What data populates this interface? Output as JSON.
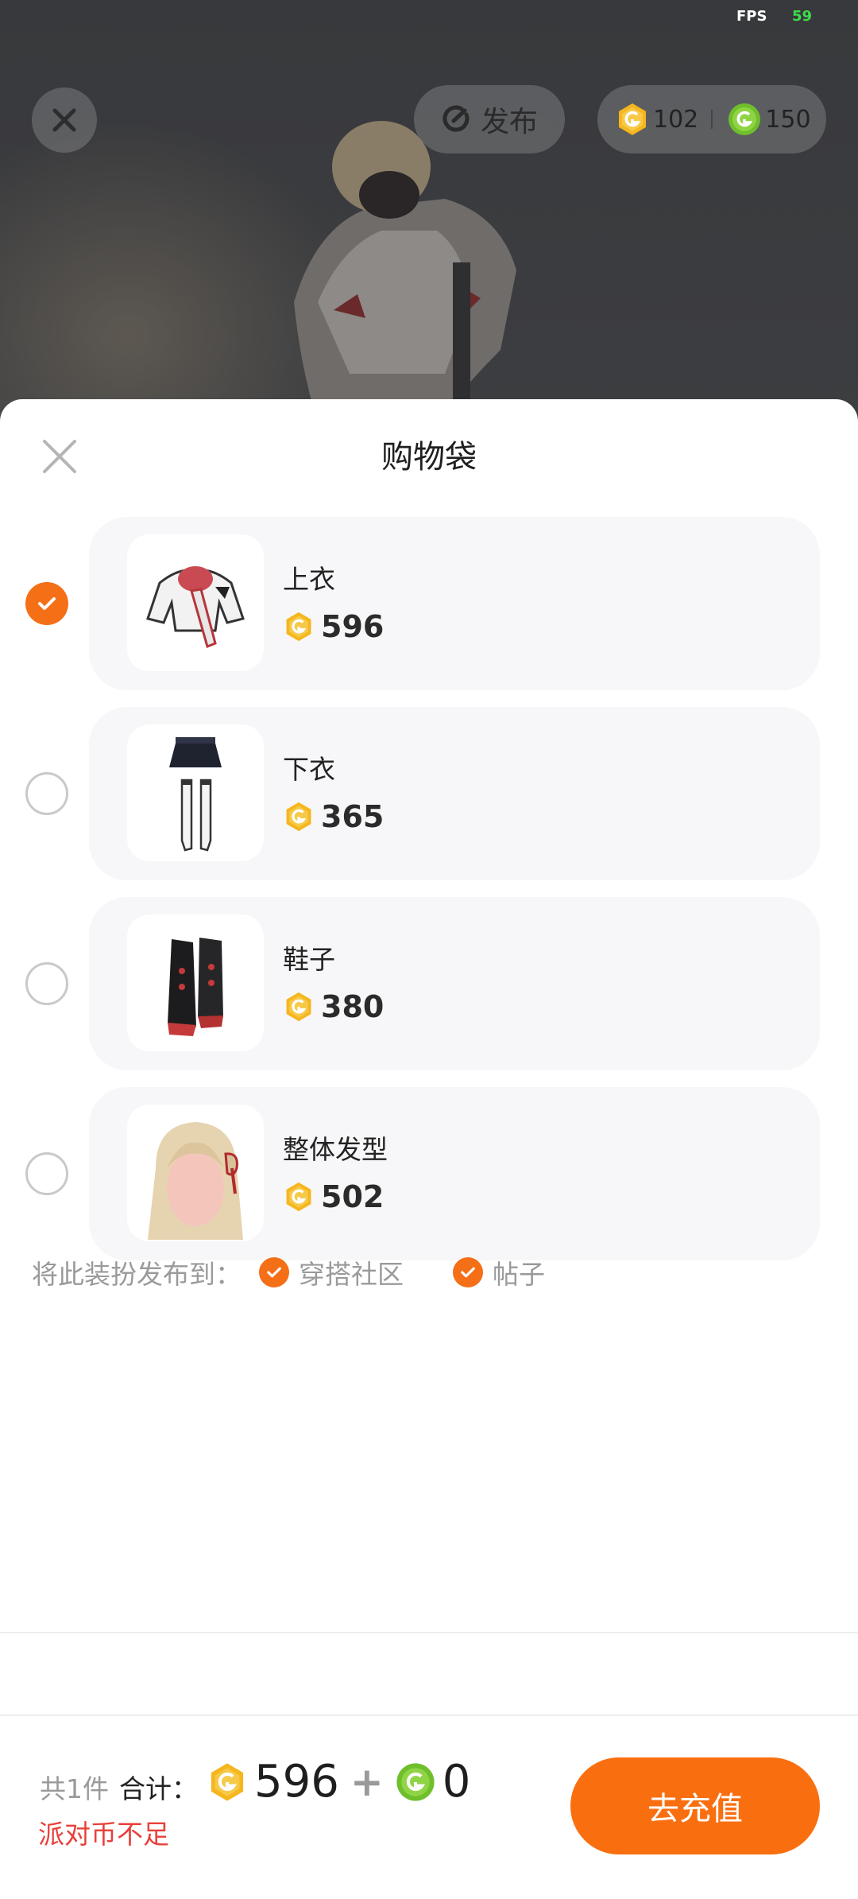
{
  "status": {
    "fps_label": "FPS",
    "fps_value": "59"
  },
  "header": {
    "publish_label": "发布",
    "currency_gold": "102",
    "currency_green": "150"
  },
  "sheet": {
    "title": "购物袋",
    "items": [
      {
        "name": "上衣",
        "price": "596",
        "selected": true,
        "thumb_icon": "jacket-icon"
      },
      {
        "name": "下衣",
        "price": "365",
        "selected": false,
        "thumb_icon": "skirt-stockings-icon"
      },
      {
        "name": "鞋子",
        "price": "380",
        "selected": false,
        "thumb_icon": "boots-icon"
      },
      {
        "name": "整体发型",
        "price": "502",
        "selected": false,
        "thumb_icon": "hairstyle-icon"
      }
    ],
    "publish_to": {
      "label": "将此装扮发布到：",
      "options": [
        {
          "label": "穿搭社区",
          "checked": true
        },
        {
          "label": "帖子",
          "checked": true
        }
      ]
    },
    "footer": {
      "count": "共1件",
      "total_label": "合计：",
      "total_gold": "596",
      "plus": "+",
      "total_green": "0",
      "warning": "派对币不足",
      "recharge_button": "去充值"
    }
  },
  "colors": {
    "accent": "#f56f17",
    "gold_coin": "#f5b61e",
    "green_coin": "#7ec83a",
    "warning": "#e8403a"
  }
}
